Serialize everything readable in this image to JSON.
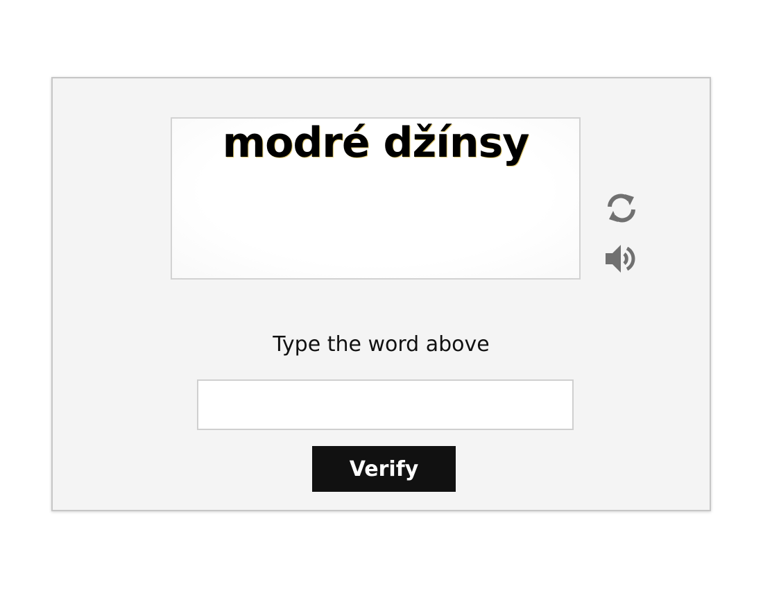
{
  "captcha": {
    "challenge_text": "modré džínsy",
    "prompt": "Type the word above",
    "input_value": "",
    "verify_label": "Verify",
    "icons": {
      "refresh": "refresh-icon",
      "audio": "speaker-icon"
    },
    "colors": {
      "panel_background": "#f4f4f4",
      "button_background": "#111111",
      "button_text": "#ffffff",
      "icon": "#707070"
    }
  }
}
